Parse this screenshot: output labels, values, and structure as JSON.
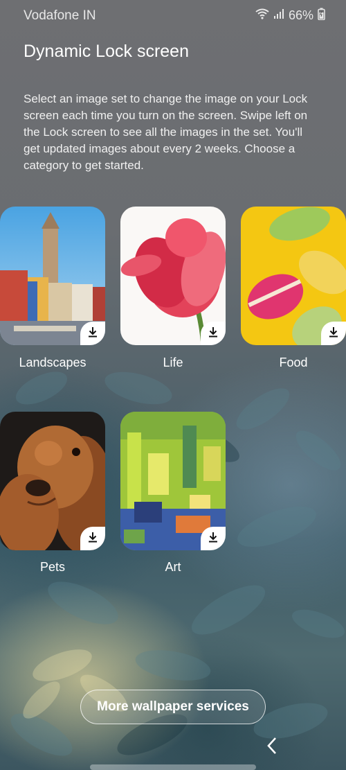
{
  "status": {
    "carrier": "Vodafone IN",
    "battery": "66%",
    "icons": [
      "wifi-icon",
      "signal-icon",
      "battery-icon"
    ]
  },
  "page": {
    "title": "Dynamic Lock screen",
    "description": "Select an image set to change the image on your Lock screen each time you turn on the screen. Swipe left on the Lock screen to see all the images in the set. You'll get updated images about every 2 weeks. Choose a category to get started."
  },
  "categories": [
    {
      "label": "Landscapes",
      "icon": "download-icon"
    },
    {
      "label": "Life",
      "icon": "download-icon"
    },
    {
      "label": "Food",
      "icon": "download-icon"
    },
    {
      "label": "Pets",
      "icon": "download-icon"
    },
    {
      "label": "Art",
      "icon": "download-icon"
    }
  ],
  "footer": {
    "more_button": "More wallpaper services",
    "back_icon": "chevron-left-icon"
  },
  "colors": {
    "text": "#ffffff",
    "button_border": "#ffffff"
  }
}
